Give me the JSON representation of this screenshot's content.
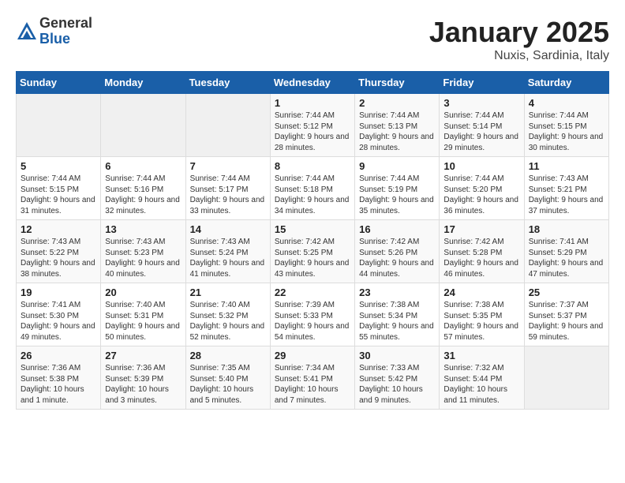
{
  "header": {
    "logo_general": "General",
    "logo_blue": "Blue",
    "month_title": "January 2025",
    "subtitle": "Nuxis, Sardinia, Italy"
  },
  "weekdays": [
    "Sunday",
    "Monday",
    "Tuesday",
    "Wednesday",
    "Thursday",
    "Friday",
    "Saturday"
  ],
  "weeks": [
    [
      {
        "day": "",
        "info": ""
      },
      {
        "day": "",
        "info": ""
      },
      {
        "day": "",
        "info": ""
      },
      {
        "day": "1",
        "info": "Sunrise: 7:44 AM\nSunset: 5:12 PM\nDaylight: 9 hours and 28 minutes."
      },
      {
        "day": "2",
        "info": "Sunrise: 7:44 AM\nSunset: 5:13 PM\nDaylight: 9 hours and 28 minutes."
      },
      {
        "day": "3",
        "info": "Sunrise: 7:44 AM\nSunset: 5:14 PM\nDaylight: 9 hours and 29 minutes."
      },
      {
        "day": "4",
        "info": "Sunrise: 7:44 AM\nSunset: 5:15 PM\nDaylight: 9 hours and 30 minutes."
      }
    ],
    [
      {
        "day": "5",
        "info": "Sunrise: 7:44 AM\nSunset: 5:15 PM\nDaylight: 9 hours and 31 minutes."
      },
      {
        "day": "6",
        "info": "Sunrise: 7:44 AM\nSunset: 5:16 PM\nDaylight: 9 hours and 32 minutes."
      },
      {
        "day": "7",
        "info": "Sunrise: 7:44 AM\nSunset: 5:17 PM\nDaylight: 9 hours and 33 minutes."
      },
      {
        "day": "8",
        "info": "Sunrise: 7:44 AM\nSunset: 5:18 PM\nDaylight: 9 hours and 34 minutes."
      },
      {
        "day": "9",
        "info": "Sunrise: 7:44 AM\nSunset: 5:19 PM\nDaylight: 9 hours and 35 minutes."
      },
      {
        "day": "10",
        "info": "Sunrise: 7:44 AM\nSunset: 5:20 PM\nDaylight: 9 hours and 36 minutes."
      },
      {
        "day": "11",
        "info": "Sunrise: 7:43 AM\nSunset: 5:21 PM\nDaylight: 9 hours and 37 minutes."
      }
    ],
    [
      {
        "day": "12",
        "info": "Sunrise: 7:43 AM\nSunset: 5:22 PM\nDaylight: 9 hours and 38 minutes."
      },
      {
        "day": "13",
        "info": "Sunrise: 7:43 AM\nSunset: 5:23 PM\nDaylight: 9 hours and 40 minutes."
      },
      {
        "day": "14",
        "info": "Sunrise: 7:43 AM\nSunset: 5:24 PM\nDaylight: 9 hours and 41 minutes."
      },
      {
        "day": "15",
        "info": "Sunrise: 7:42 AM\nSunset: 5:25 PM\nDaylight: 9 hours and 43 minutes."
      },
      {
        "day": "16",
        "info": "Sunrise: 7:42 AM\nSunset: 5:26 PM\nDaylight: 9 hours and 44 minutes."
      },
      {
        "day": "17",
        "info": "Sunrise: 7:42 AM\nSunset: 5:28 PM\nDaylight: 9 hours and 46 minutes."
      },
      {
        "day": "18",
        "info": "Sunrise: 7:41 AM\nSunset: 5:29 PM\nDaylight: 9 hours and 47 minutes."
      }
    ],
    [
      {
        "day": "19",
        "info": "Sunrise: 7:41 AM\nSunset: 5:30 PM\nDaylight: 9 hours and 49 minutes."
      },
      {
        "day": "20",
        "info": "Sunrise: 7:40 AM\nSunset: 5:31 PM\nDaylight: 9 hours and 50 minutes."
      },
      {
        "day": "21",
        "info": "Sunrise: 7:40 AM\nSunset: 5:32 PM\nDaylight: 9 hours and 52 minutes."
      },
      {
        "day": "22",
        "info": "Sunrise: 7:39 AM\nSunset: 5:33 PM\nDaylight: 9 hours and 54 minutes."
      },
      {
        "day": "23",
        "info": "Sunrise: 7:38 AM\nSunset: 5:34 PM\nDaylight: 9 hours and 55 minutes."
      },
      {
        "day": "24",
        "info": "Sunrise: 7:38 AM\nSunset: 5:35 PM\nDaylight: 9 hours and 57 minutes."
      },
      {
        "day": "25",
        "info": "Sunrise: 7:37 AM\nSunset: 5:37 PM\nDaylight: 9 hours and 59 minutes."
      }
    ],
    [
      {
        "day": "26",
        "info": "Sunrise: 7:36 AM\nSunset: 5:38 PM\nDaylight: 10 hours and 1 minute."
      },
      {
        "day": "27",
        "info": "Sunrise: 7:36 AM\nSunset: 5:39 PM\nDaylight: 10 hours and 3 minutes."
      },
      {
        "day": "28",
        "info": "Sunrise: 7:35 AM\nSunset: 5:40 PM\nDaylight: 10 hours and 5 minutes."
      },
      {
        "day": "29",
        "info": "Sunrise: 7:34 AM\nSunset: 5:41 PM\nDaylight: 10 hours and 7 minutes."
      },
      {
        "day": "30",
        "info": "Sunrise: 7:33 AM\nSunset: 5:42 PM\nDaylight: 10 hours and 9 minutes."
      },
      {
        "day": "31",
        "info": "Sunrise: 7:32 AM\nSunset: 5:44 PM\nDaylight: 10 hours and 11 minutes."
      },
      {
        "day": "",
        "info": ""
      }
    ]
  ]
}
